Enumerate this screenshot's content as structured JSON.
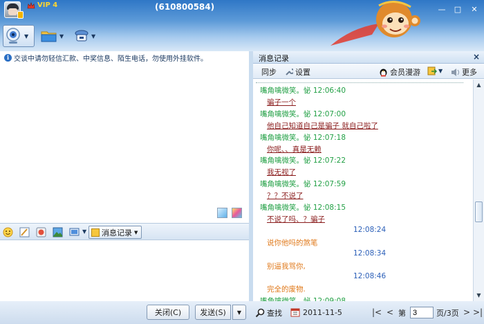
{
  "titlebar": {
    "vip": "VIP 4",
    "qq_number": "(610800584)",
    "min": "—",
    "max": "□",
    "close": "✕"
  },
  "notice": {
    "text": "交谈中请勿轻信汇款、中奖信息、陌生电话，勿使用外挂软件。"
  },
  "input_toolbar": {
    "message_log_label": "消息记录"
  },
  "buttons": {
    "close_label": "关闭(C)",
    "send_label": "发送(S)"
  },
  "message_panel": {
    "title": "消息记录",
    "close": "×",
    "tools": {
      "sync": "同步",
      "settings": "设置",
      "member_roaming": "会员漫游",
      "more": "更多"
    },
    "messages": [
      {
        "kind": "sender",
        "text": "嘴角噙微笑。怭 12:06:40"
      },
      {
        "kind": "msg",
        "text": "骗子一个"
      },
      {
        "kind": "sender",
        "text": "嘴角噙微笑。怭 12:07:00"
      },
      {
        "kind": "msg",
        "text": "他自己知道自己是骗子  就自己啦了"
      },
      {
        "kind": "sender",
        "text": "嘴角噙微笑。怭 12:07:18"
      },
      {
        "kind": "msg",
        "text": "你呢、、真是无赖"
      },
      {
        "kind": "sender",
        "text": "嘴角噙微笑。怭 12:07:22"
      },
      {
        "kind": "msg",
        "text": "我无视了"
      },
      {
        "kind": "sender",
        "text": "嘴角噙微笑。怭 12:07:59"
      },
      {
        "kind": "msg",
        "text": "？？不说了"
      },
      {
        "kind": "sender",
        "text": "嘴角噙微笑。怭 12:08:15"
      },
      {
        "kind": "msg",
        "text": "不说了吗、？骗子"
      },
      {
        "kind": "mytime",
        "text": "12:08:24"
      },
      {
        "kind": "mymsg",
        "text": "说你他吗的煞笔"
      },
      {
        "kind": "mytime",
        "text": "12:08:34"
      },
      {
        "kind": "mymsg",
        "text": "别逼我骂你,"
      },
      {
        "kind": "mytime",
        "text": "12:08:46"
      },
      {
        "kind": "mymsg",
        "text": "完全的废物."
      },
      {
        "kind": "sender",
        "text": "嘴角噙微笑。怭 12:09:08"
      }
    ],
    "bottom": {
      "search": "查找",
      "date": "2011-11-5",
      "page_prefix": "第",
      "page_value": "3",
      "page_suffix": "页/3页"
    }
  },
  "colors": {
    "title_blue": "#2f77c6",
    "sender_green": "#22a045",
    "message_red": "#8a1c1c",
    "my_time_blue": "#2b5fb8",
    "my_message_orange": "#e07a1c"
  }
}
